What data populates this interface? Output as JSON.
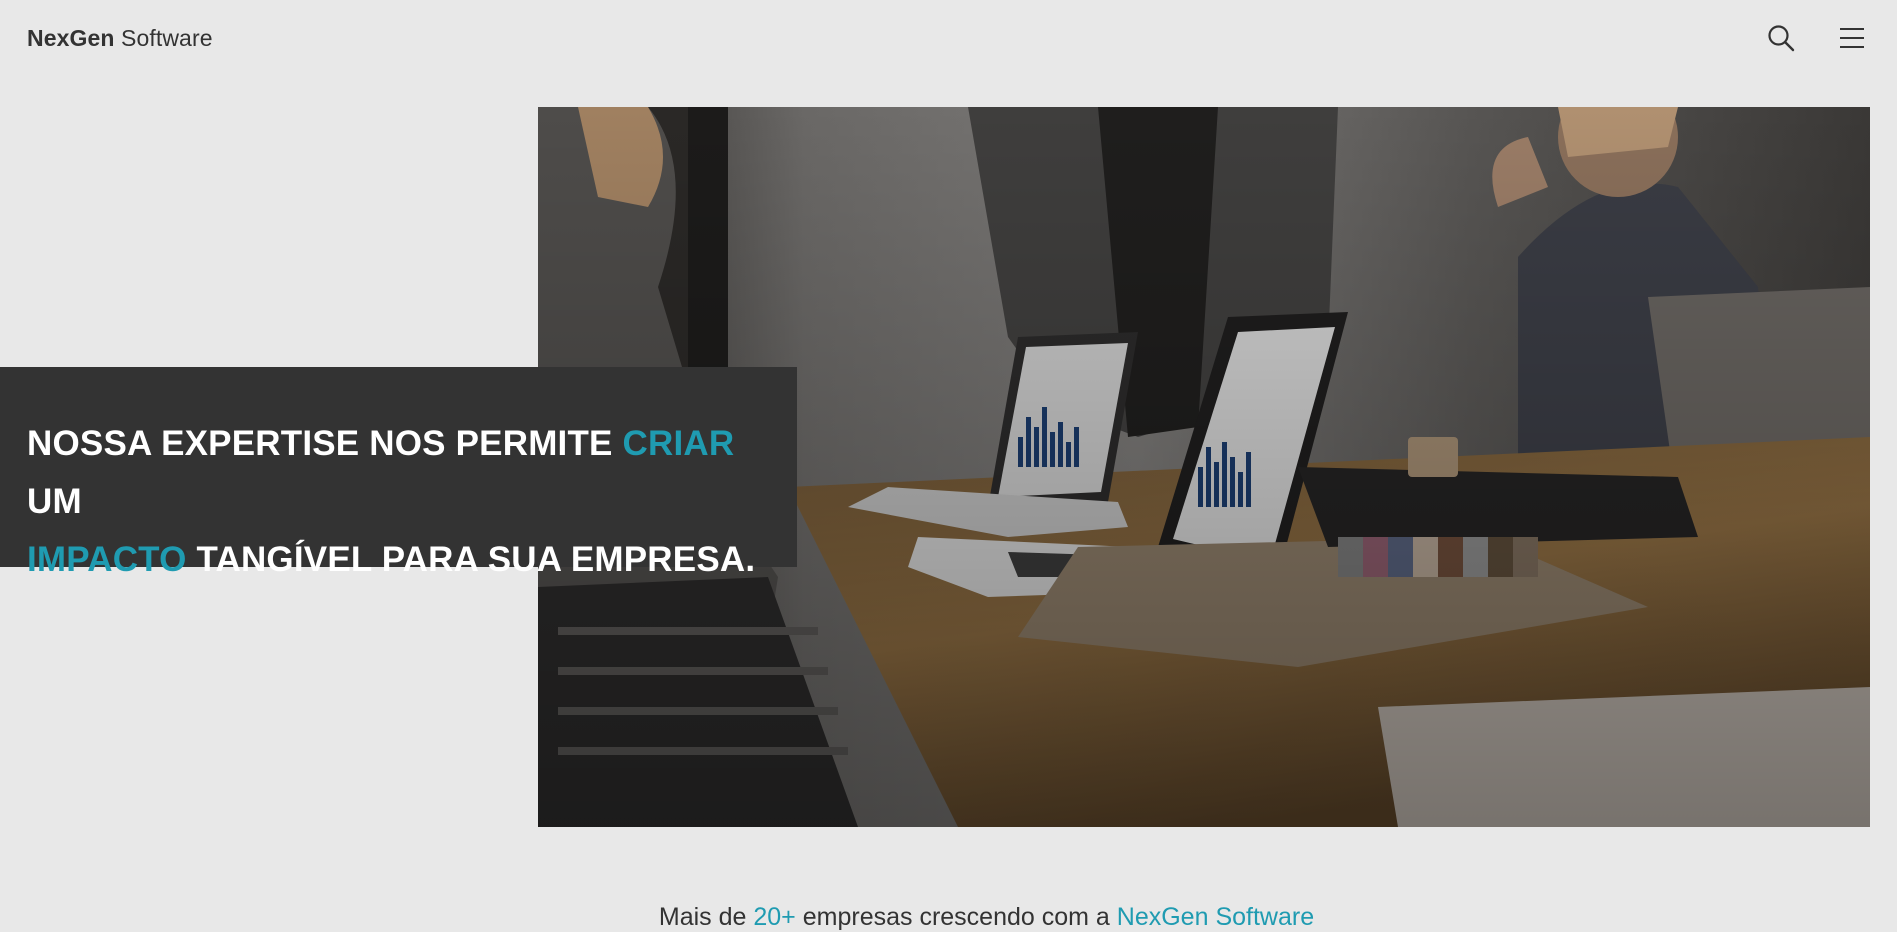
{
  "brand": {
    "name_bold": "NexGen",
    "name_light": "Software"
  },
  "header": {
    "search_icon": "search-icon",
    "menu_icon": "hamburger-menu-icon"
  },
  "hero": {
    "tagline_part1": "NOSSA EXPERTISE NOS PERMITE ",
    "tagline_accent1": "CRIAR",
    "tagline_part2": " UM",
    "tagline_accent2": "IMPACTO",
    "tagline_part3": " TANGÍVEL PARA SUA EMPRESA."
  },
  "clients": {
    "prefix": "Mais de ",
    "count": "20+",
    "middle": " empresas crescendo com a ",
    "brand": "NexGen Software"
  },
  "colors": {
    "background": "#e8e8e8",
    "text": "#333333",
    "accent": "#1f9bb1",
    "tagline_box": "#333333"
  }
}
